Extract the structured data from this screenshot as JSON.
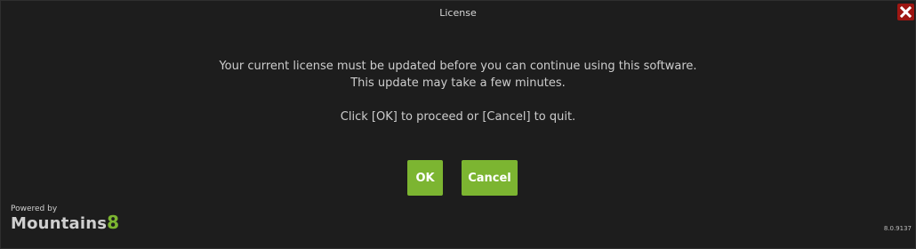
{
  "window": {
    "title": "License",
    "close_icon": "close-icon"
  },
  "message": {
    "line1": "Your current license must be updated before you can continue using this software.",
    "line2": "This update may take a few minutes.",
    "line3": "Click [OK] to proceed or [Cancel] to quit."
  },
  "buttons": {
    "ok_label": "OK",
    "cancel_label": "Cancel"
  },
  "branding": {
    "powered_by": "Powered by",
    "product_name": "Mountains",
    "product_version_mark": "8"
  },
  "version": "8.0.9137",
  "colors": {
    "background": "#1d1d1d",
    "accent": "#7cb531",
    "close": "#9e1612",
    "text": "#cdcdcd"
  }
}
